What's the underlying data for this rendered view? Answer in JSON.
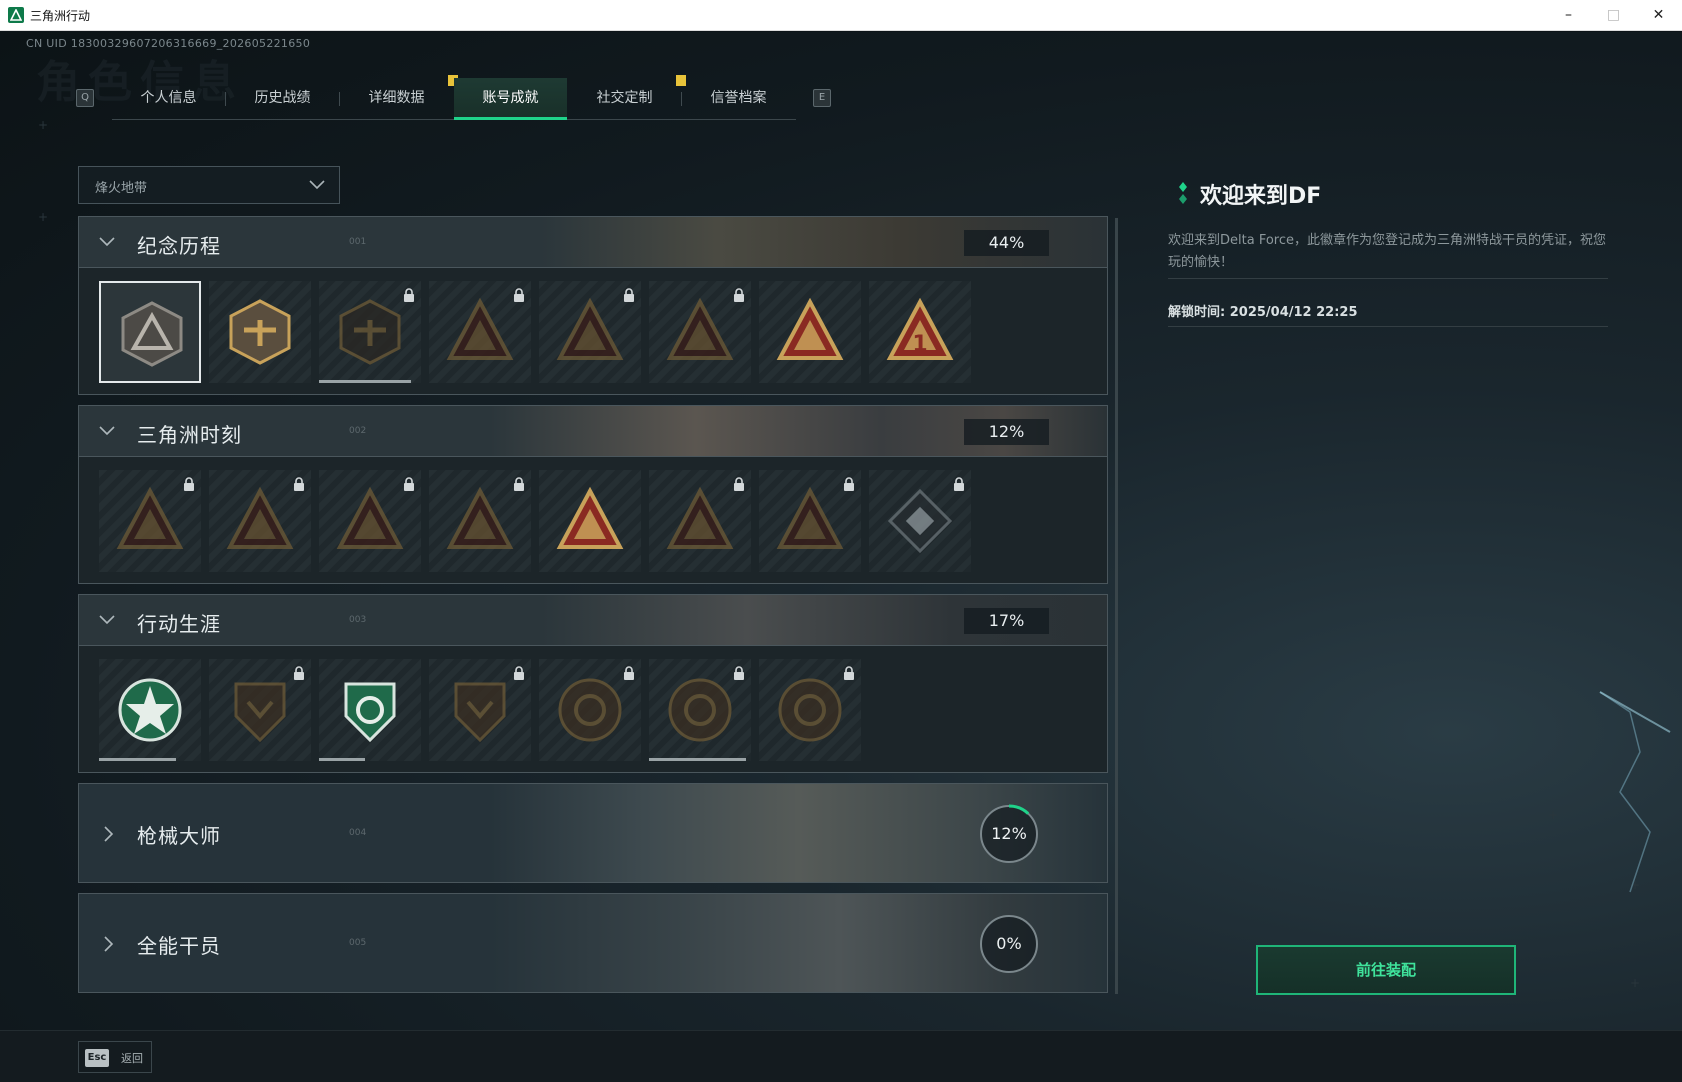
{
  "window": {
    "title": "三角洲行动",
    "minimize": "–",
    "maximize": "□",
    "close": "✕"
  },
  "uid": "CN UID 18300329607206316669_202605221650",
  "bg_title": "角色信息",
  "tabs": [
    {
      "label": "个人信息",
      "active": false,
      "notice": false
    },
    {
      "label": "历史战绩",
      "active": false,
      "notice": false
    },
    {
      "label": "详细数据",
      "active": false,
      "notice": true
    },
    {
      "label": "账号成就",
      "active": true,
      "notice": false
    },
    {
      "label": "社交定制",
      "active": false,
      "notice": true
    },
    {
      "label": "信誉档案",
      "active": false,
      "notice": false
    }
  ],
  "tab_keys": {
    "prev": "Q",
    "next": "E"
  },
  "mode_select": {
    "value": "烽火地带"
  },
  "categories": [
    {
      "name": "纪念历程",
      "index": "001",
      "percent": "44%",
      "expanded": true,
      "badges": [
        {
          "icon": "delta-emblem-icon",
          "locked": false,
          "selected": true
        },
        {
          "icon": "helicopter-badge-icon",
          "locked": false
        },
        {
          "icon": "shield-emblem-icon",
          "locked": true,
          "progress": 0.9
        },
        {
          "icon": "soldier-badge-icon",
          "locked": true
        },
        {
          "icon": "hooded-figure-badge-icon",
          "locked": true
        },
        {
          "icon": "crossed-blades-badge-icon",
          "locked": true
        },
        {
          "icon": "phoenix-triangle-icon",
          "locked": false
        },
        {
          "icon": "number-one-triangle-icon",
          "locked": false
        }
      ]
    },
    {
      "name": "三角洲时刻",
      "index": "002",
      "percent": "12%",
      "expanded": true,
      "badges": [
        {
          "icon": "robot-triangle-icon",
          "locked": true
        },
        {
          "icon": "helmet-triangle-icon",
          "locked": true
        },
        {
          "icon": "runner-triangle-icon",
          "locked": true
        },
        {
          "icon": "heart-triangle-icon",
          "locked": true
        },
        {
          "icon": "team-triangle-icon",
          "locked": false
        },
        {
          "icon": "eagle-triangle-icon",
          "locked": true
        },
        {
          "icon": "fish-triangle-icon",
          "locked": true
        },
        {
          "icon": "cube-diamond-icon",
          "locked": true
        }
      ]
    },
    {
      "name": "行动生涯",
      "index": "003",
      "percent": "17%",
      "expanded": true,
      "badges": [
        {
          "icon": "green-star-medal-icon",
          "locked": false,
          "progress": 0.75
        },
        {
          "icon": "wing-shield-medal-icon",
          "locked": true
        },
        {
          "icon": "green-shield-medal-icon",
          "locked": false,
          "progress": 0.45
        },
        {
          "icon": "hex-shield-medal-icon",
          "locked": true
        },
        {
          "icon": "helmet-round-medal-icon",
          "locked": true
        },
        {
          "icon": "skull-round-medal-icon",
          "locked": true,
          "progress": 0.95
        },
        {
          "icon": "eye-round-medal-icon",
          "locked": true
        }
      ]
    },
    {
      "name": "枪械大师",
      "index": "004",
      "percent": "12%",
      "expanded": false,
      "ring": 0.12
    },
    {
      "name": "全能干员",
      "index": "005",
      "percent": "0%",
      "expanded": false,
      "ring": 0
    }
  ],
  "detail": {
    "title": "欢迎来到DF",
    "description": "欢迎来到Delta Force，此徽章作为您登记成为三角洲特战干员的凭证，祝您玩的愉快！",
    "unlock": "解锁时间: 2025/04/12 22:25"
  },
  "equip_button": "前往装配",
  "back": {
    "key": "Esc",
    "label": "返回"
  },
  "colors": {
    "accent": "#1fd38a",
    "badge_gold": "#c8a25a",
    "badge_red": "#8a2a22",
    "notice": "#e8c33a"
  }
}
